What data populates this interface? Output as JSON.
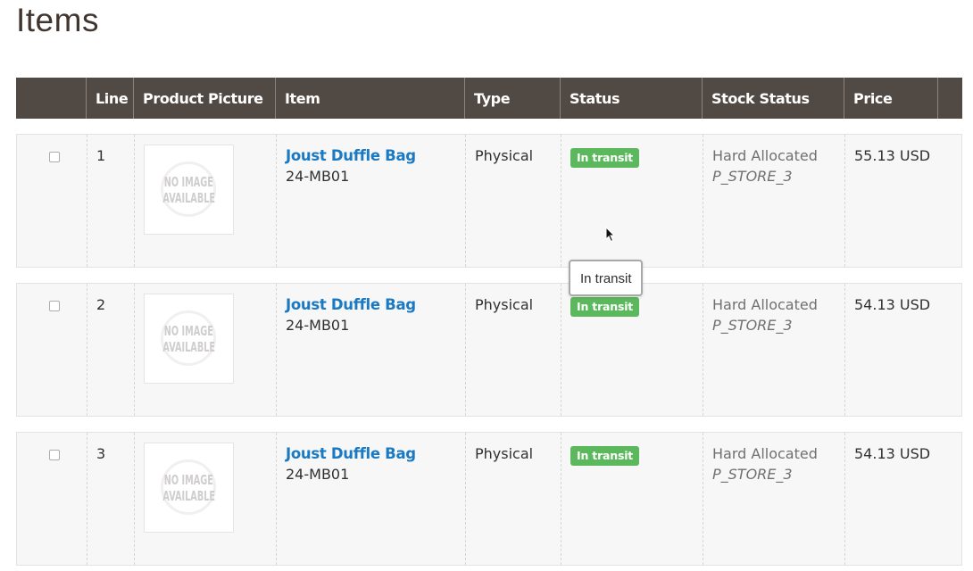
{
  "page": {
    "title": "Items"
  },
  "table": {
    "headers": {
      "select": "",
      "line": "Line",
      "product_picture": "Product Picture",
      "item": "Item",
      "type": "Type",
      "status": "Status",
      "stock_status": "Stock Status",
      "price": "Price"
    },
    "rows": [
      {
        "line": "1",
        "picture_text_1": "NO IMAGE",
        "picture_text_2": "AVAILABLE",
        "item_name": "Joust Duffle Bag",
        "sku": "24-MB01",
        "type": "Physical",
        "status": "In transit",
        "stock_status": "Hard Allocated",
        "stock_source": "P_STORE_3",
        "price": "55.13 USD",
        "checked": false
      },
      {
        "line": "2",
        "picture_text_1": "NO IMAGE",
        "picture_text_2": "AVAILABLE",
        "item_name": "Joust Duffle Bag",
        "sku": "24-MB01",
        "type": "Physical",
        "status": "In transit",
        "stock_status": "Hard Allocated",
        "stock_source": "P_STORE_3",
        "price": "54.13 USD",
        "checked": false
      },
      {
        "line": "3",
        "picture_text_1": "NO IMAGE",
        "picture_text_2": "AVAILABLE",
        "item_name": "Joust Duffle Bag",
        "sku": "24-MB01",
        "type": "Physical",
        "status": "In transit",
        "stock_status": "Hard Allocated",
        "stock_source": "P_STORE_3",
        "price": "54.13 USD",
        "checked": false
      }
    ]
  },
  "tooltip": {
    "text": "In transit"
  },
  "colors": {
    "header_bg": "#514943",
    "link": "#1979c3",
    "status_badge": "#5cb85c",
    "row_bg": "#f8f7f7"
  },
  "icons": {
    "cursor": "mouse-pointer-icon",
    "placeholder": "no-image-placeholder-icon"
  }
}
